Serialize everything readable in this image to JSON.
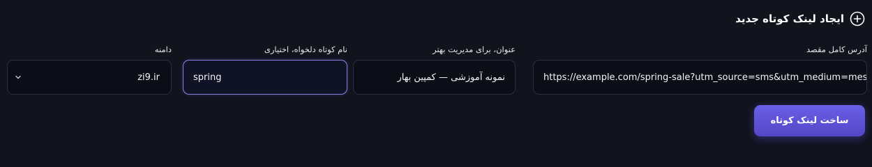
{
  "header": {
    "title": "ایجاد لینک کوتاه جدید",
    "icon": "plus-circle-icon"
  },
  "fields": {
    "destination_url": {
      "label": "آدرس کامل مقصد",
      "value": "https://example.com/spring-sale?utm_source=sms&utm_medium=mes"
    },
    "title": {
      "label": "عنوان، برای مدیریت بهتر",
      "value": "نمونه آموزشی — کمپین بهار"
    },
    "alias": {
      "label": "نام کوتاه دلخواه، اختیاری",
      "value": "spring"
    },
    "domain": {
      "label": "دامنه",
      "selected": "zi9.ir",
      "icon": "chevron-down-icon"
    }
  },
  "submit": {
    "label": "ساخت لینک کوتاه"
  },
  "colors": {
    "background": "#11131d",
    "input_background": "#0c0e17",
    "input_border": "#2b2e3d",
    "focus_border": "#8a83e6",
    "accent": "#5c50d6"
  }
}
